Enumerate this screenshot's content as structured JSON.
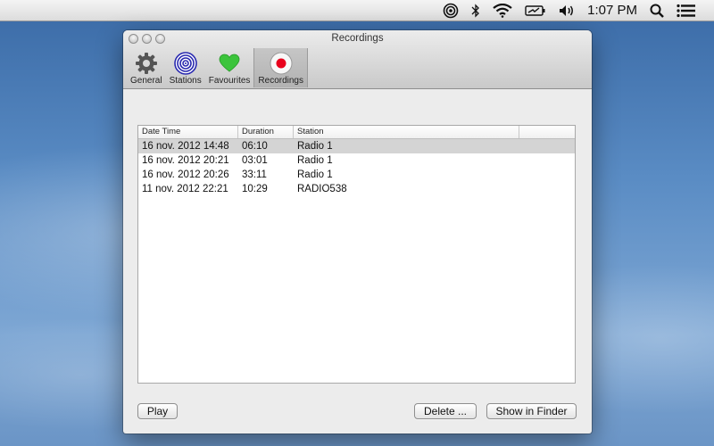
{
  "menubar": {
    "clock": "1:07 PM",
    "icons": [
      "radio-target-icon",
      "bluetooth-icon",
      "wifi-icon",
      "battery-icon",
      "volume-icon",
      "spotlight-search-icon",
      "notification-list-icon"
    ]
  },
  "window": {
    "title": "Recordings",
    "toolbar": [
      {
        "label": "General",
        "icon": "gear-icon"
      },
      {
        "label": "Stations",
        "icon": "stations-icon"
      },
      {
        "label": "Favourites",
        "icon": "heart-icon"
      },
      {
        "label": "Recordings",
        "icon": "record-icon",
        "active": true
      }
    ],
    "table": {
      "columns": [
        "Date Time",
        "Duration",
        "Station",
        ""
      ],
      "rows": [
        {
          "datetime": "16 nov. 2012 14:48",
          "duration": "06:10",
          "station": "Radio 1",
          "selected": true
        },
        {
          "datetime": "16 nov. 2012 20:21",
          "duration": "03:01",
          "station": "Radio 1"
        },
        {
          "datetime": "16 nov. 2012 20:26",
          "duration": "33:11",
          "station": "Radio 1"
        },
        {
          "datetime": "11 nov. 2012 22:21",
          "duration": "10:29",
          "station": "RADIO538"
        }
      ]
    },
    "buttons": {
      "play": "Play",
      "delete": "Delete ...",
      "show_in_finder": "Show in Finder"
    }
  },
  "colors": {
    "selected_row": "#d4d4d4",
    "record_red": "#e8001c",
    "heart_green": "#3cc43c",
    "stations_blue": "#2a2ab0"
  }
}
